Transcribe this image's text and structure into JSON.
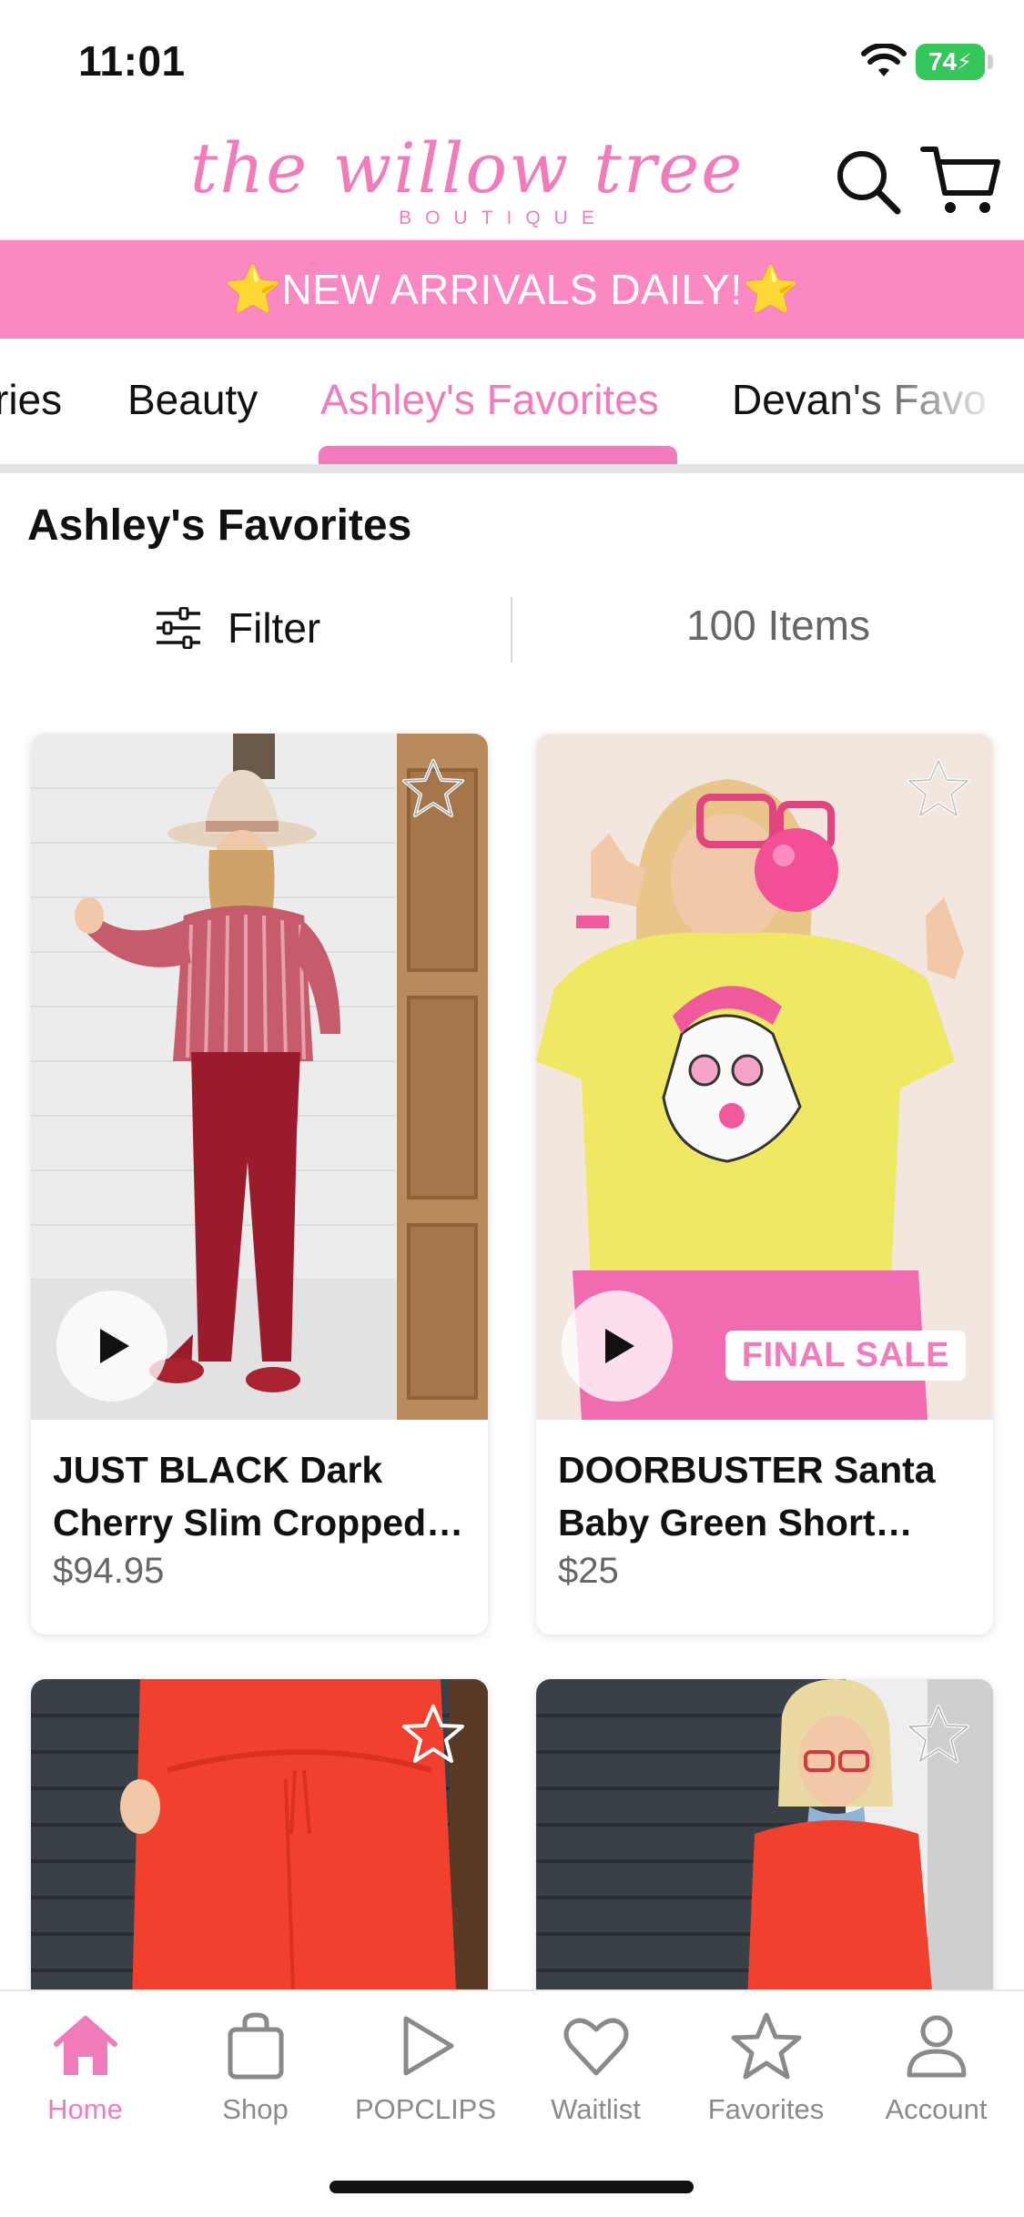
{
  "status_bar": {
    "time": "11:01",
    "battery": "74"
  },
  "header": {
    "logo_script": "the willow tree",
    "logo_sub": "BOUTIQUE",
    "icons": [
      "search-icon",
      "cart-icon"
    ]
  },
  "banner": {
    "star": "⭐",
    "text": "NEW ARRIVALS DAILY!"
  },
  "category_tabs": [
    "ries",
    "Beauty",
    "Ashley's Favorites",
    "Devan's Favo"
  ],
  "active_tab": "Ashley's Favorites",
  "section": {
    "title": "Ashley's Favorites",
    "filter_label": "Filter",
    "item_count": "100 Items"
  },
  "products": [
    {
      "name": "JUST BLACK Dark Cherry Slim Cropped Flare Jeans",
      "price": "$94.95",
      "badge": "",
      "has_video": true
    },
    {
      "name": "DOORBUSTER Santa Baby Green Short Sleeve Tee",
      "price": "$25",
      "badge": "FINAL SALE",
      "has_video": true
    },
    {
      "name": "",
      "price": "",
      "badge": "",
      "has_video": false
    },
    {
      "name": "",
      "price": "",
      "badge": "",
      "has_video": false
    }
  ],
  "tab_bar": [
    {
      "label": "Home",
      "icon": "home-icon",
      "active": true
    },
    {
      "label": "Shop",
      "icon": "shopping-bag-icon",
      "active": false
    },
    {
      "label": "POPCLIPS",
      "icon": "play-icon",
      "active": false
    },
    {
      "label": "Waitlist",
      "icon": "heart-icon",
      "active": false
    },
    {
      "label": "Favorites",
      "icon": "star-icon",
      "active": false
    },
    {
      "label": "Account",
      "icon": "person-icon",
      "active": false
    }
  ],
  "colors": {
    "brand_pink": "#f07cbc",
    "banner_pink": "#fa88c2",
    "battery_green": "#34c759"
  }
}
